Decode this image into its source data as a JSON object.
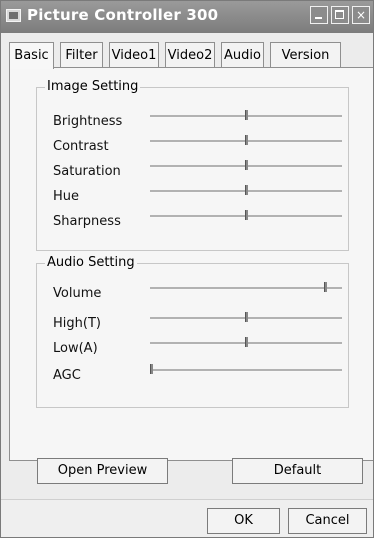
{
  "window": {
    "title": "Picture Controller 300"
  },
  "tabs": [
    {
      "label": "Basic",
      "active": true
    },
    {
      "label": "Filter",
      "active": false
    },
    {
      "label": "Video1",
      "active": false
    },
    {
      "label": "Video2",
      "active": false
    },
    {
      "label": "Audio",
      "active": false
    },
    {
      "label": "Version Info",
      "active": false
    }
  ],
  "image_setting": {
    "title": "Image Setting",
    "items": [
      {
        "label": "Brightness",
        "value": 0.5
      },
      {
        "label": "Contrast",
        "value": 0.5
      },
      {
        "label": "Saturation",
        "value": 0.5
      },
      {
        "label": "Hue",
        "value": 0.5
      },
      {
        "label": "Sharpness",
        "value": 0.5
      }
    ]
  },
  "audio_setting": {
    "title": "Audio Setting",
    "items": [
      {
        "label": "Volume",
        "value": 0.92
      },
      {
        "label": "High(T)",
        "value": 0.5
      },
      {
        "label": "Low(A)",
        "value": 0.5
      },
      {
        "label": "AGC",
        "value": 0.0
      }
    ]
  },
  "buttons": {
    "open_preview": "Open Preview",
    "default": "Default",
    "ok": "OK",
    "cancel": "Cancel"
  }
}
